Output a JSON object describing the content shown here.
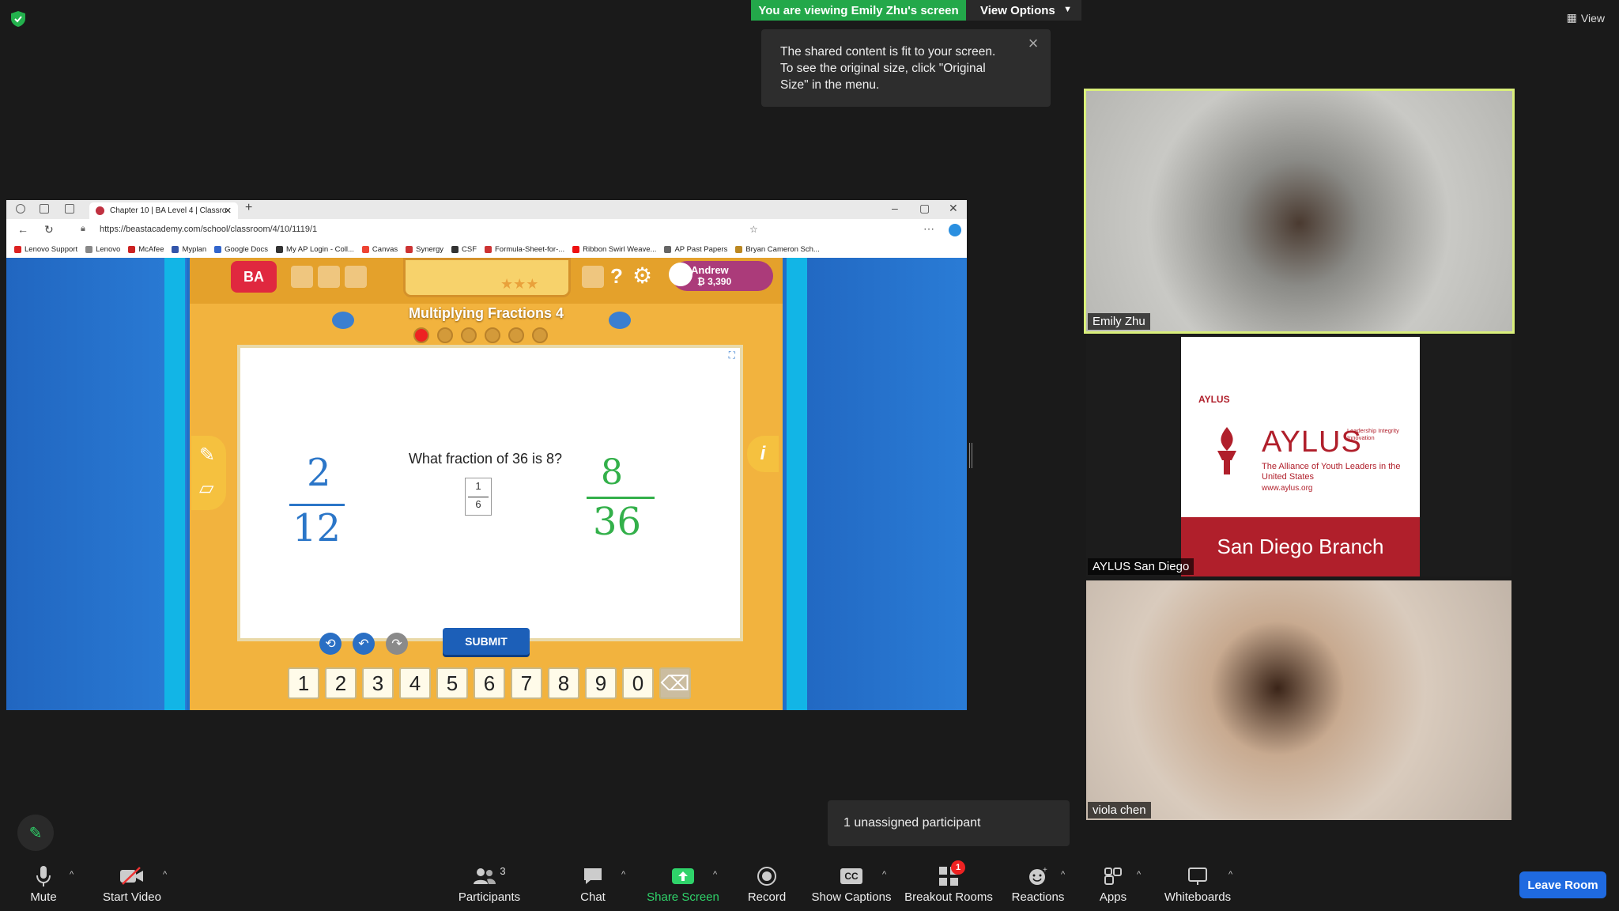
{
  "banner": {
    "viewing": "You are viewing Emily Zhu's screen",
    "view_options": "View Options"
  },
  "tooltip": {
    "text": "The shared content is fit to your screen. To see the original size, click \"Original Size\" in the menu."
  },
  "view_btn": "View",
  "browser": {
    "tab_title": "Chapter 10 | BA Level 4 | Classro",
    "url": "https://beastacademy.com/school/classroom/4/10/1119/1",
    "bookmarks": [
      {
        "label": "Lenovo Support",
        "color": "#d22"
      },
      {
        "label": "Lenovo",
        "color": "#888"
      },
      {
        "label": "McAfee",
        "color": "#c22"
      },
      {
        "label": "Myplan",
        "color": "#35a"
      },
      {
        "label": "Google Docs",
        "color": "#36c"
      },
      {
        "label": "My AP Login - Coll...",
        "color": "#333"
      },
      {
        "label": "Canvas",
        "color": "#e43"
      },
      {
        "label": "Synergy",
        "color": "#c33"
      },
      {
        "label": "CSF",
        "color": "#333"
      },
      {
        "label": "Formula-Sheet-for-...",
        "color": "#c33"
      },
      {
        "label": "Ribbon Swirl Weave...",
        "color": "#e11"
      },
      {
        "label": "AP Past Papers",
        "color": "#666"
      },
      {
        "label": "Bryan Cameron Sch...",
        "color": "#b82"
      }
    ]
  },
  "game": {
    "logo": "BA",
    "user_name": "Andrew",
    "user_coins": "₿ 3,390",
    "lesson_title": "Multiplying Fractions 4",
    "question": "What fraction of 36 is 8?",
    "answer_numerator": "1",
    "answer_denominator": "6",
    "submit": "SUBMIT",
    "keys": [
      "1",
      "2",
      "3",
      "4",
      "5",
      "6",
      "7",
      "8",
      "9",
      "0"
    ],
    "handwritten_left": {
      "num": "2",
      "den": "12"
    },
    "handwritten_right": {
      "num": "8",
      "den": "36"
    },
    "info": "i"
  },
  "tiles": {
    "emily": "Emily Zhu",
    "aylus": "AYLUS San Diego",
    "viola": "viola chen"
  },
  "aylus_card": {
    "small": "AYLUS",
    "big": "AYLUS",
    "tagline": "Leadership Integrity Innovation",
    "full": "The Alliance of Youth Leaders in the United States",
    "url": "www.aylus.org",
    "branch": "San Diego Branch"
  },
  "unassigned": "1 unassigned participant",
  "toolbar": {
    "mute": "Mute",
    "start_video": "Start Video",
    "participants": "Participants",
    "participants_count": "3",
    "chat": "Chat",
    "share_screen": "Share Screen",
    "record": "Record",
    "captions": "Show Captions",
    "breakout": "Breakout Rooms",
    "breakout_badge": "1",
    "reactions": "Reactions",
    "apps": "Apps",
    "whiteboards": "Whiteboards",
    "leave": "Leave Room"
  },
  "colors": {
    "share_green": "#2fd36a",
    "active_speaker": "#d9ef7a",
    "leave_blue": "#1f6ae0",
    "aylus_red": "#b01f2b"
  }
}
